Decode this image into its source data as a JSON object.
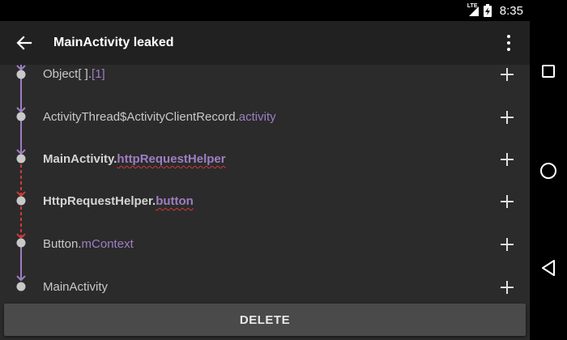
{
  "status_bar": {
    "network_label": "LTE",
    "time": "8:35"
  },
  "app_bar": {
    "title": "MainActivity leaked"
  },
  "trace": {
    "rows": [
      {
        "class_name": "Object[ ].",
        "field": "[1]",
        "bold": false,
        "squiggle": false
      },
      {
        "class_name": "ActivityThread$ActivityClientRecord.",
        "field": "activity",
        "bold": false,
        "squiggle": false
      },
      {
        "class_name": "MainActivity.",
        "field": "httpRequestHelper",
        "bold": true,
        "squiggle": true
      },
      {
        "class_name": "HttpRequestHelper.",
        "field": "button",
        "bold": true,
        "squiggle": true
      },
      {
        "class_name": "Button.",
        "field": "mContext",
        "bold": false,
        "squiggle": false
      },
      {
        "class_name": "MainActivity",
        "field": "",
        "bold": false,
        "squiggle": false
      }
    ]
  },
  "footer": {
    "delete_label": "DELETE"
  },
  "colors": {
    "app_bar": "#212121",
    "content_bg": "#2b2b2b",
    "field_accent": "#9e7ec2",
    "leak_line": "#d03a3a",
    "normal_line": "#9e7ec2"
  },
  "icons": {
    "back": "arrow-back-icon",
    "overflow": "more-vert-icon",
    "expand": "plus-icon",
    "nav_recents": "square-icon",
    "nav_home": "circle-icon",
    "nav_back": "triangle-back-icon"
  }
}
